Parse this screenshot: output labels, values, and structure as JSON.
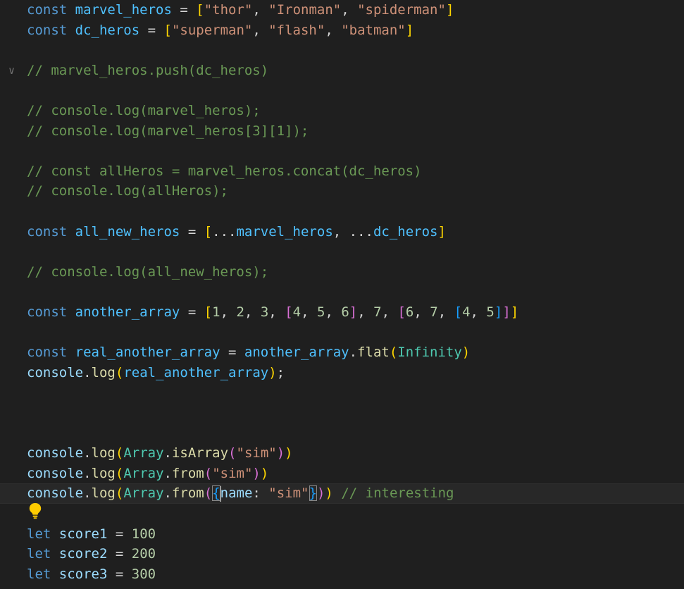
{
  "editor": {
    "lines": [
      {
        "id": 1,
        "tokens": [
          {
            "t": "const",
            "c": "keyword"
          },
          {
            "t": " "
          },
          {
            "t": "marvel_heros",
            "c": "const"
          },
          {
            "t": " = "
          },
          {
            "t": "[",
            "c": "b1"
          },
          {
            "t": "\"thor\"",
            "c": "string"
          },
          {
            "t": ", "
          },
          {
            "t": "\"Ironman\"",
            "c": "string"
          },
          {
            "t": ", "
          },
          {
            "t": "\"spiderman\"",
            "c": "string"
          },
          {
            "t": "]",
            "c": "b1"
          }
        ]
      },
      {
        "id": 2,
        "tokens": [
          {
            "t": "const",
            "c": "keyword"
          },
          {
            "t": " "
          },
          {
            "t": "dc_heros",
            "c": "const"
          },
          {
            "t": " = "
          },
          {
            "t": "[",
            "c": "b1"
          },
          {
            "t": "\"superman\"",
            "c": "string"
          },
          {
            "t": ", "
          },
          {
            "t": "\"flash\"",
            "c": "string"
          },
          {
            "t": ", "
          },
          {
            "t": "\"batman\"",
            "c": "string"
          },
          {
            "t": "]",
            "c": "b1"
          }
        ]
      },
      {
        "id": 3,
        "tokens": []
      },
      {
        "id": 4,
        "fold": true,
        "tokens": [
          {
            "t": "// marvel_heros.push(dc_heros)",
            "c": "comment"
          }
        ]
      },
      {
        "id": 5,
        "tokens": []
      },
      {
        "id": 6,
        "tokens": [
          {
            "t": "// console.log(marvel_heros);",
            "c": "comment"
          }
        ]
      },
      {
        "id": 7,
        "tokens": [
          {
            "t": "// console.log(marvel_heros[3][1]);",
            "c": "comment"
          }
        ]
      },
      {
        "id": 8,
        "tokens": []
      },
      {
        "id": 9,
        "tokens": [
          {
            "t": "// const allHeros = marvel_heros.concat(dc_heros)",
            "c": "comment"
          }
        ]
      },
      {
        "id": 10,
        "tokens": [
          {
            "t": "// console.log(allHeros);",
            "c": "comment"
          }
        ]
      },
      {
        "id": 11,
        "tokens": []
      },
      {
        "id": 12,
        "tokens": [
          {
            "t": "const",
            "c": "keyword"
          },
          {
            "t": " "
          },
          {
            "t": "all_new_heros",
            "c": "const"
          },
          {
            "t": " = "
          },
          {
            "t": "[",
            "c": "b1"
          },
          {
            "t": "..."
          },
          {
            "t": "marvel_heros",
            "c": "const"
          },
          {
            "t": ", ..."
          },
          {
            "t": "dc_heros",
            "c": "const"
          },
          {
            "t": "]",
            "c": "b1"
          }
        ]
      },
      {
        "id": 13,
        "tokens": []
      },
      {
        "id": 14,
        "tokens": [
          {
            "t": "// console.log(all_new_heros);",
            "c": "comment"
          }
        ]
      },
      {
        "id": 15,
        "tokens": []
      },
      {
        "id": 16,
        "tokens": [
          {
            "t": "const",
            "c": "keyword"
          },
          {
            "t": " "
          },
          {
            "t": "another_array",
            "c": "const"
          },
          {
            "t": " = "
          },
          {
            "t": "[",
            "c": "b1"
          },
          {
            "t": "1",
            "c": "number"
          },
          {
            "t": ", "
          },
          {
            "t": "2",
            "c": "number"
          },
          {
            "t": ", "
          },
          {
            "t": "3",
            "c": "number"
          },
          {
            "t": ", "
          },
          {
            "t": "[",
            "c": "b2"
          },
          {
            "t": "4",
            "c": "number"
          },
          {
            "t": ", "
          },
          {
            "t": "5",
            "c": "number"
          },
          {
            "t": ", "
          },
          {
            "t": "6",
            "c": "number"
          },
          {
            "t": "]",
            "c": "b2"
          },
          {
            "t": ", "
          },
          {
            "t": "7",
            "c": "number"
          },
          {
            "t": ", "
          },
          {
            "t": "[",
            "c": "b2"
          },
          {
            "t": "6",
            "c": "number"
          },
          {
            "t": ", "
          },
          {
            "t": "7",
            "c": "number"
          },
          {
            "t": ", "
          },
          {
            "t": "[",
            "c": "b3"
          },
          {
            "t": "4",
            "c": "number"
          },
          {
            "t": ", "
          },
          {
            "t": "5",
            "c": "number"
          },
          {
            "t": "]",
            "c": "b3"
          },
          {
            "t": "]",
            "c": "b2"
          },
          {
            "t": "]",
            "c": "b1"
          }
        ]
      },
      {
        "id": 17,
        "tokens": []
      },
      {
        "id": 18,
        "tokens": [
          {
            "t": "const",
            "c": "keyword"
          },
          {
            "t": " "
          },
          {
            "t": "real_another_array",
            "c": "const"
          },
          {
            "t": " = "
          },
          {
            "t": "another_array",
            "c": "const"
          },
          {
            "t": "."
          },
          {
            "t": "flat",
            "c": "func"
          },
          {
            "t": "(",
            "c": "b1"
          },
          {
            "t": "Infinity",
            "c": "class"
          },
          {
            "t": ")",
            "c": "b1"
          }
        ]
      },
      {
        "id": 19,
        "tokens": [
          {
            "t": "console",
            "c": "prop"
          },
          {
            "t": "."
          },
          {
            "t": "log",
            "c": "func"
          },
          {
            "t": "(",
            "c": "b1"
          },
          {
            "t": "real_another_array",
            "c": "const"
          },
          {
            "t": ")",
            "c": "b1"
          },
          {
            "t": ";"
          }
        ]
      },
      {
        "id": 20,
        "tokens": []
      },
      {
        "id": 21,
        "tokens": []
      },
      {
        "id": 22,
        "tokens": []
      },
      {
        "id": 23,
        "tokens": [
          {
            "t": "console",
            "c": "prop"
          },
          {
            "t": "."
          },
          {
            "t": "log",
            "c": "func"
          },
          {
            "t": "(",
            "c": "b1"
          },
          {
            "t": "Array",
            "c": "class"
          },
          {
            "t": "."
          },
          {
            "t": "isArray",
            "c": "func"
          },
          {
            "t": "(",
            "c": "b2"
          },
          {
            "t": "\"sim\"",
            "c": "string"
          },
          {
            "t": ")",
            "c": "b2"
          },
          {
            "t": ")",
            "c": "b1"
          }
        ]
      },
      {
        "id": 24,
        "tokens": [
          {
            "t": "console",
            "c": "prop"
          },
          {
            "t": "."
          },
          {
            "t": "log",
            "c": "func"
          },
          {
            "t": "(",
            "c": "b1"
          },
          {
            "t": "Array",
            "c": "class"
          },
          {
            "t": "."
          },
          {
            "t": "from",
            "c": "func"
          },
          {
            "t": "(",
            "c": "b2"
          },
          {
            "t": "\"sim\"",
            "c": "string"
          },
          {
            "t": ")",
            "c": "b2"
          },
          {
            "t": ")",
            "c": "b1"
          }
        ]
      },
      {
        "id": 25,
        "current": true,
        "tokens": [
          {
            "t": "console",
            "c": "prop"
          },
          {
            "t": "."
          },
          {
            "t": "log",
            "c": "func"
          },
          {
            "t": "(",
            "c": "b1"
          },
          {
            "t": "Array",
            "c": "class"
          },
          {
            "t": "."
          },
          {
            "t": "from",
            "c": "func"
          },
          {
            "t": "(",
            "c": "b2"
          },
          {
            "t": "{",
            "c": "b3",
            "match": true
          },
          {
            "cursor": true
          },
          {
            "t": "name",
            "c": "prop"
          },
          {
            "t": ": "
          },
          {
            "t": "\"sim\"",
            "c": "string"
          },
          {
            "t": "}",
            "c": "b3",
            "match": true
          },
          {
            "t": ")",
            "c": "b2"
          },
          {
            "t": ")",
            "c": "b1"
          },
          {
            "t": " "
          },
          {
            "t": "// interesting",
            "c": "comment"
          }
        ]
      },
      {
        "id": 26,
        "lightbulb": true,
        "tokens": []
      },
      {
        "id": 27,
        "tokens": [
          {
            "t": "let",
            "c": "keyword"
          },
          {
            "t": " "
          },
          {
            "t": "score1",
            "c": "param"
          },
          {
            "t": " = "
          },
          {
            "t": "100",
            "c": "number"
          }
        ]
      },
      {
        "id": 28,
        "tokens": [
          {
            "t": "let",
            "c": "keyword"
          },
          {
            "t": " "
          },
          {
            "t": "score2",
            "c": "param"
          },
          {
            "t": " = "
          },
          {
            "t": "200",
            "c": "number"
          }
        ]
      },
      {
        "id": 29,
        "tokens": [
          {
            "t": "let",
            "c": "keyword"
          },
          {
            "t": " "
          },
          {
            "t": "score3",
            "c": "param"
          },
          {
            "t": " = "
          },
          {
            "t": "300",
            "c": "number"
          }
        ]
      }
    ]
  },
  "icons": {
    "fold": "chevron-down-icon",
    "lightbulb": "lightbulb-icon"
  },
  "colors": {
    "background": "#1f1f1f",
    "current_line": "#282828",
    "keyword": "#569cd6",
    "constant": "#4fc1ff",
    "string": "#ce9178",
    "number": "#b5cea8",
    "comment": "#6a9955",
    "function": "#dcdcaa",
    "class": "#4ec9b0",
    "bracket_level1": "#ffd700",
    "bracket_level2": "#da70d6",
    "bracket_level3": "#179fff",
    "lightbulb": "#ffcc00"
  }
}
